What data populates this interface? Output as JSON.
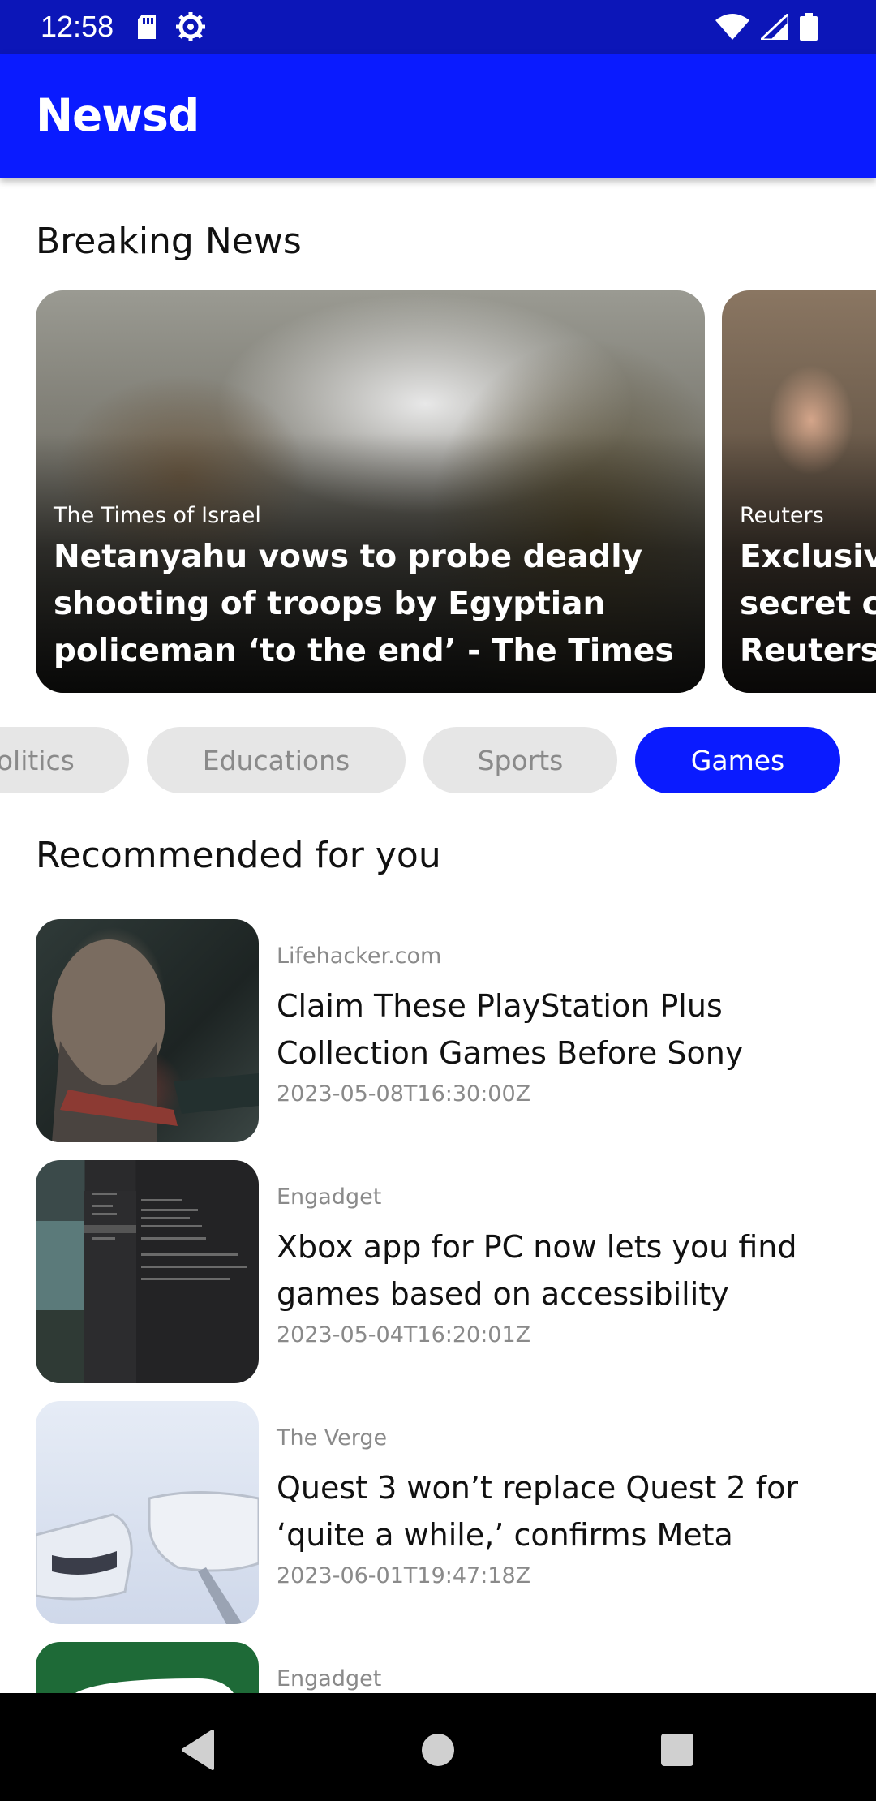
{
  "status_bar": {
    "time": "12:58",
    "icons": [
      "sd-card-icon",
      "settings-icon",
      "wifi-icon",
      "signal-icon",
      "battery-icon"
    ]
  },
  "app_bar": {
    "title": "Newsd"
  },
  "breaking": {
    "title": "Breaking News",
    "cards": [
      {
        "source": "The Times of Israel",
        "title": "Netanyahu vows to probe deadly shooting of troops by Egyptian policeman ‘to the end’ - The Times of"
      },
      {
        "source": "Reuters",
        "title": "Exclusive secret co Reuters.c"
      }
    ]
  },
  "categories": {
    "items": [
      "Politics",
      "Educations",
      "Sports",
      "Games"
    ],
    "selected": "Games"
  },
  "recommended": {
    "title": "Recommended for you",
    "items": [
      {
        "source": "Lifehacker.com",
        "title": "Claim These PlayStation Plus Collection Games Before Sony",
        "date": "2023-05-08T16:30:00Z"
      },
      {
        "source": "Engadget",
        "title": "Xbox app for PC now lets you find games based on accessibility",
        "date": "2023-05-04T16:20:01Z"
      },
      {
        "source": "The Verge",
        "title": "Quest 3 won’t replace Quest 2 for ‘quite a while,’ confirms Meta",
        "date": "2023-06-01T19:47:18Z"
      },
      {
        "source": "Engadget",
        "title": "",
        "date": ""
      }
    ]
  },
  "nav_bar": {
    "buttons": [
      "back-icon",
      "home-icon",
      "recents-icon"
    ]
  },
  "colors": {
    "primary": "#0a1bff",
    "status_bar": "#0c16b8",
    "chip_inactive": "#e6e6e6",
    "secondary_text": "#8a8a8a"
  }
}
